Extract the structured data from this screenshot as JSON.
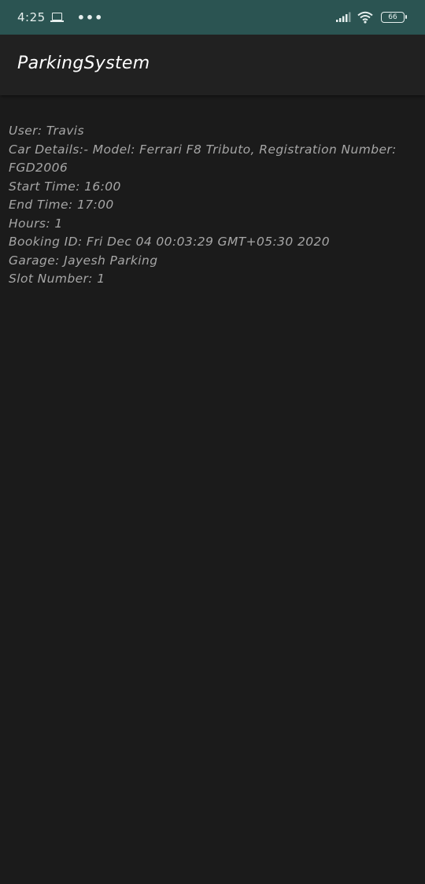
{
  "status_bar": {
    "time": "4:25",
    "more_indicator": "•••",
    "battery_level": "66",
    "bg_color": "#2b5452"
  },
  "app_bar": {
    "title": "ParkingSystem"
  },
  "booking": {
    "user": "User: Travis",
    "car_details": "Car Details:- Model: Ferrari F8 Tributo, Registration Number: FGD2006",
    "start_time": "Start Time: 16:00",
    "end_time": "End Time: 17:00",
    "hours": "Hours: 1",
    "booking_id": "Booking ID: Fri Dec 04 00:03:29 GMT+05:30 2020",
    "garage": "Garage: Jayesh Parking",
    "slot_number": "Slot Number: 1"
  },
  "icons": {
    "screen_cast": "laptop-icon",
    "signal": "signal-icon",
    "wifi": "wifi-icon",
    "battery": "battery-icon"
  }
}
